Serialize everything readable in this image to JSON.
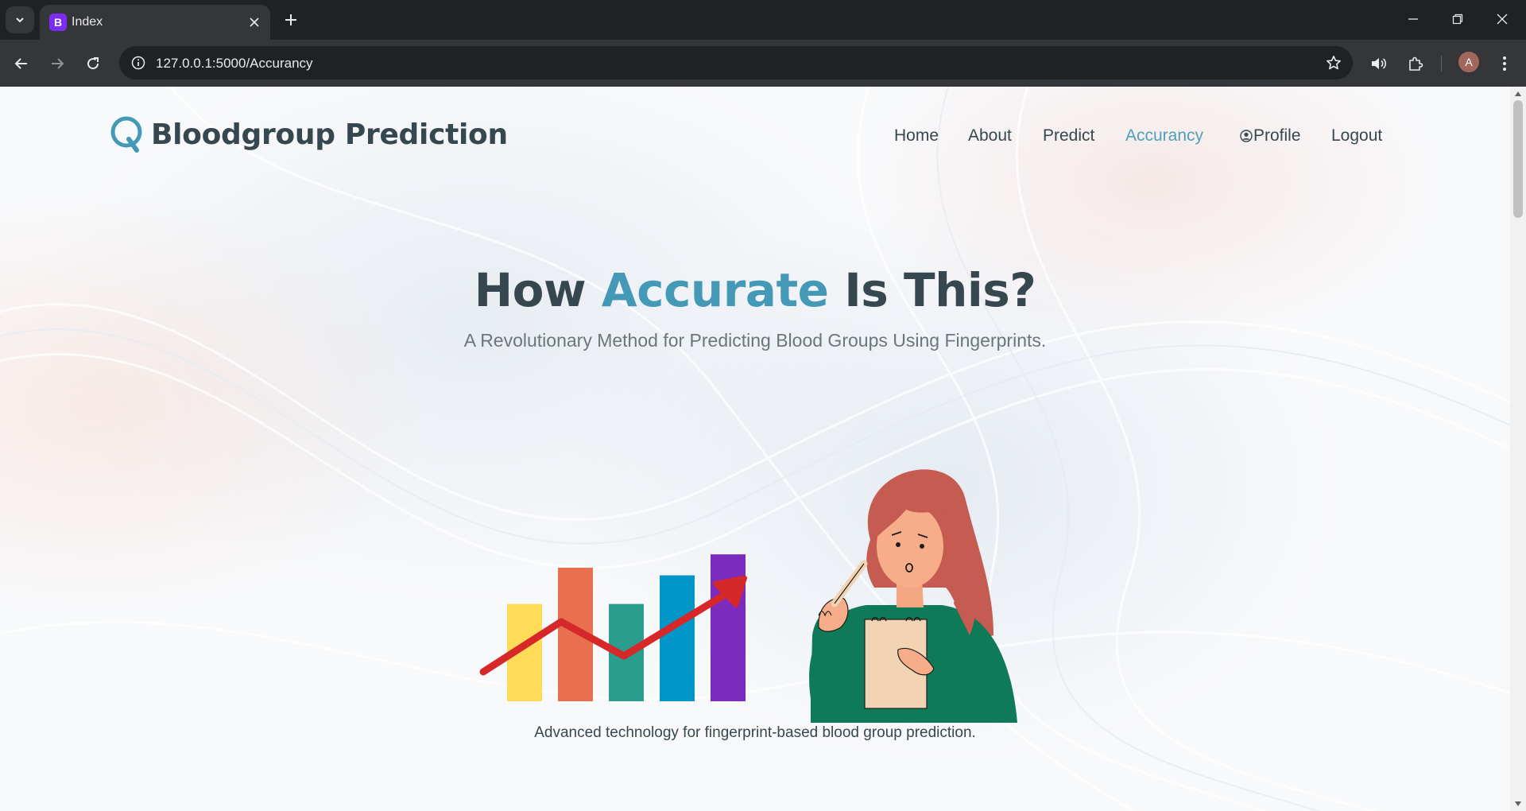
{
  "browser": {
    "tab_title": "Index",
    "tab_favicon_letter": "B",
    "url": "127.0.0.1:5000/Accurancy",
    "profile_initial": "A",
    "accent_color": "#7b2cf0"
  },
  "site": {
    "brand": "Bloodgroup Prediction",
    "brand_color": "#4499b6",
    "nav": [
      {
        "label": "Home",
        "active": false
      },
      {
        "label": "About",
        "active": false
      },
      {
        "label": "Predict",
        "active": false
      },
      {
        "label": "Accurancy",
        "active": true
      },
      {
        "label": "Profile",
        "active": false,
        "icon": "user-circle-icon"
      },
      {
        "label": "Logout",
        "active": false
      }
    ]
  },
  "hero": {
    "title_part1": "How ",
    "title_accent": "Accurate",
    "title_part2": " Is This?",
    "subtitle": "A Revolutionary Method for Predicting Blood Groups Using Fingerprints.",
    "caption": "Advanced technology for fingerprint-based blood group prediction."
  },
  "illustration": {
    "bar_colors": [
      "#ffdb58",
      "#e8704f",
      "#2a9d8f",
      "#0096c7",
      "#7b2cbf"
    ],
    "bar_levels": [
      0.51,
      0.7,
      0.51,
      0.66,
      0.77
    ],
    "arrow_color": "#d62828"
  }
}
